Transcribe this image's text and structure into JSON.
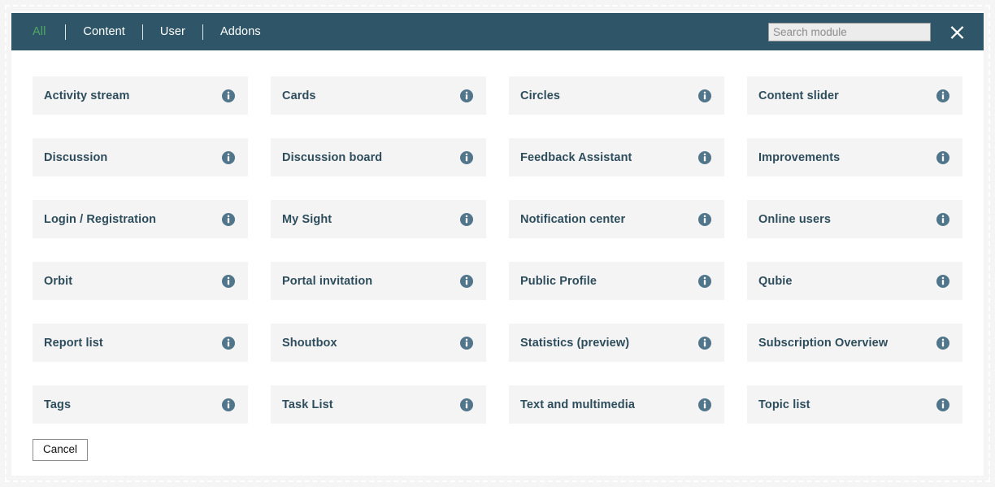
{
  "header": {
    "tabs": [
      {
        "label": "All",
        "active": true
      },
      {
        "label": "Content",
        "active": false
      },
      {
        "label": "User",
        "active": false
      },
      {
        "label": "Addons",
        "active": false
      }
    ],
    "search": {
      "placeholder": "Search module",
      "value": ""
    },
    "close_icon": "close-icon",
    "background_color": "#2f5668",
    "active_tab_color": "#4fa863"
  },
  "modules": [
    {
      "name": "Activity stream",
      "info_icon": "info-icon"
    },
    {
      "name": "Cards",
      "info_icon": "info-icon"
    },
    {
      "name": "Circles",
      "info_icon": "info-icon"
    },
    {
      "name": "Content slider",
      "info_icon": "info-icon"
    },
    {
      "name": "Discussion",
      "info_icon": "info-icon"
    },
    {
      "name": "Discussion board",
      "info_icon": "info-icon"
    },
    {
      "name": "Feedback Assistant",
      "info_icon": "info-icon"
    },
    {
      "name": "Improvements",
      "info_icon": "info-icon"
    },
    {
      "name": "Login / Registration",
      "info_icon": "info-icon"
    },
    {
      "name": "My Sight",
      "info_icon": "info-icon"
    },
    {
      "name": "Notification center",
      "info_icon": "info-icon"
    },
    {
      "name": "Online users",
      "info_icon": "info-icon"
    },
    {
      "name": "Orbit",
      "info_icon": "info-icon"
    },
    {
      "name": "Portal invitation",
      "info_icon": "info-icon"
    },
    {
      "name": "Public Profile",
      "info_icon": "info-icon"
    },
    {
      "name": "Qubie",
      "info_icon": "info-icon"
    },
    {
      "name": "Report list",
      "info_icon": "info-icon"
    },
    {
      "name": "Shoutbox",
      "info_icon": "info-icon"
    },
    {
      "name": "Statistics (preview)",
      "info_icon": "info-icon"
    },
    {
      "name": "Subscription Overview",
      "info_icon": "info-icon"
    },
    {
      "name": "Tags",
      "info_icon": "info-icon"
    },
    {
      "name": "Task List",
      "info_icon": "info-icon"
    },
    {
      "name": "Text and multimedia",
      "info_icon": "info-icon"
    },
    {
      "name": "Topic list",
      "info_icon": "info-icon"
    }
  ],
  "footer": {
    "cancel_label": "Cancel"
  },
  "colors": {
    "header": "#2f5668",
    "active_tab": "#4fa863",
    "card_background": "#f4f4f4",
    "card_text": "#2e4d5c",
    "info_icon": "#51758a"
  }
}
